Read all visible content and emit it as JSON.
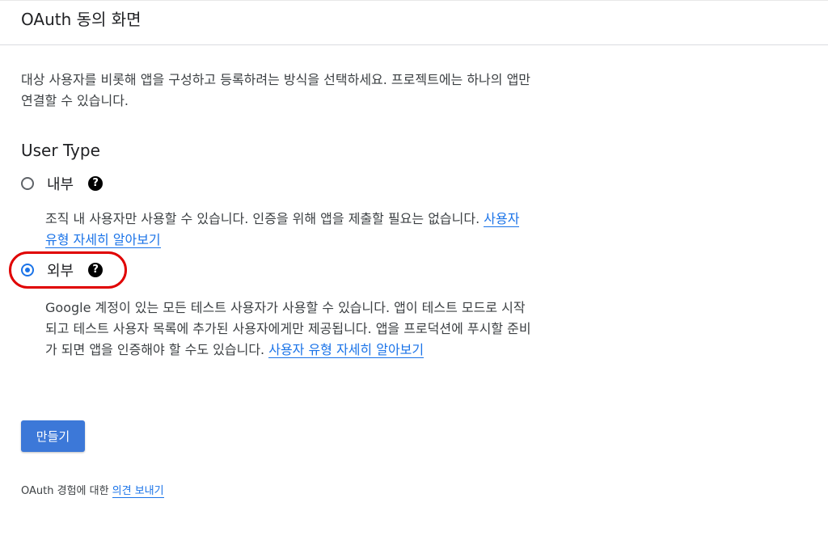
{
  "header": {
    "title": "OAuth 동의 화면"
  },
  "intro": {
    "text": "대상 사용자를 비롯해 앱을 구성하고 등록하려는 방식을 선택하세요. 프로젝트에는 하나의 앱만 연결할 수 있습니다."
  },
  "user_type": {
    "title": "User Type",
    "options": [
      {
        "label": "내부",
        "selected": false,
        "help_icon": "help-icon",
        "description": "조직 내 사용자만 사용할 수 있습니다. 인증을 위해 앱을 제출할 필요는 없습니다. ",
        "link": "사용자 유형 자세히 알아보기"
      },
      {
        "label": "외부",
        "selected": true,
        "help_icon": "help-icon",
        "description": "Google 계정이 있는 모든 테스트 사용자가 사용할 수 있습니다. 앱이 테스트 모드로 시작되고 테스트 사용자 목록에 추가된 사용자에게만 제공됩니다. 앱을 프로덕션에 푸시할 준비가 되면 앱을 인증해야 할 수도 있습니다. ",
        "link": "사용자 유형 자세히 알아보기"
      }
    ]
  },
  "actions": {
    "create_label": "만들기"
  },
  "feedback": {
    "prefix": "OAuth 경험에 대한 ",
    "link": "의견 보내기"
  },
  "colors": {
    "accent": "#1a73e8",
    "button": "#3c78d8",
    "highlight": "#e00000"
  }
}
